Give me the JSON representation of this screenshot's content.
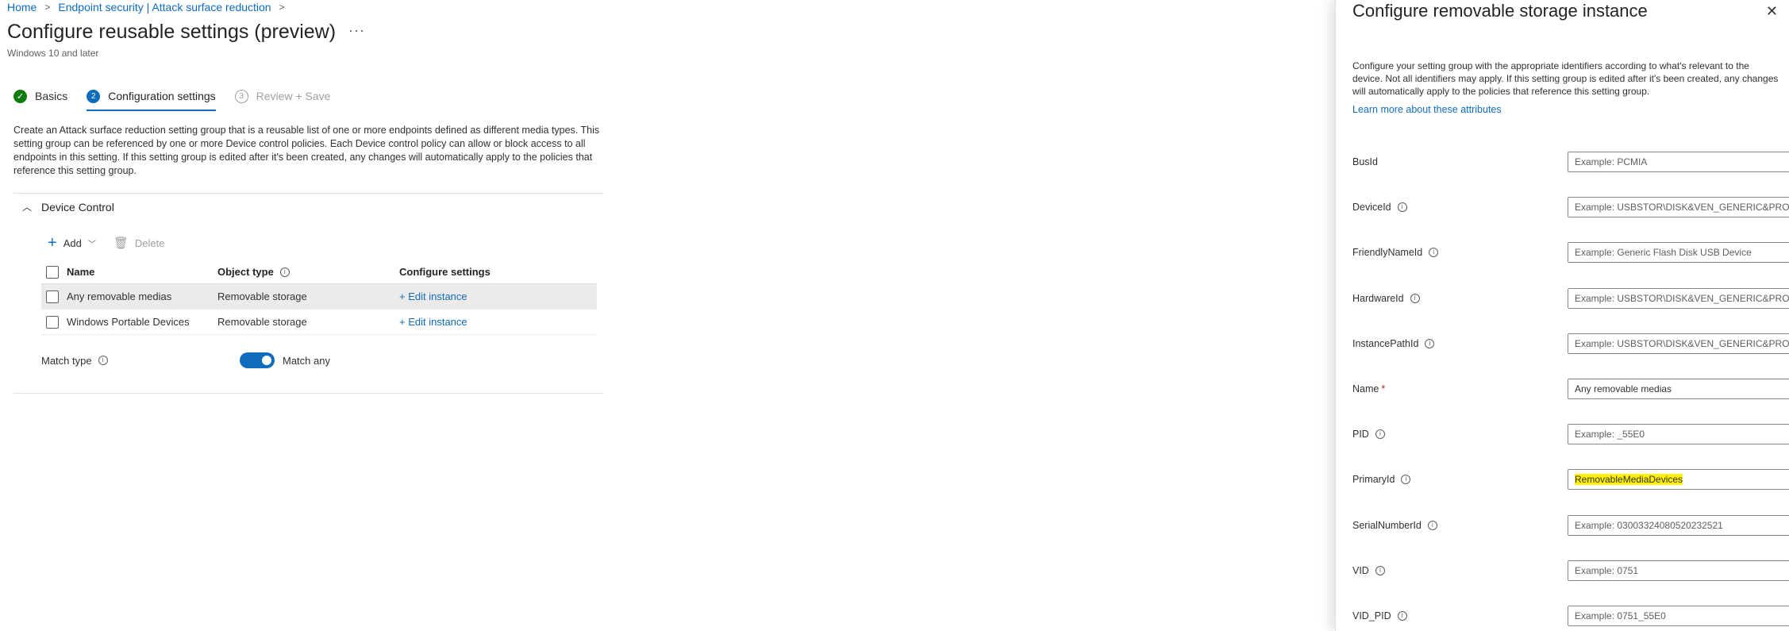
{
  "breadcrumb": [
    "Home",
    "Endpoint security | Attack surface reduction"
  ],
  "page": {
    "title": "Configure reusable settings (preview)",
    "more": "···",
    "subtitle": "Windows 10 and later"
  },
  "steps": [
    {
      "number": "✓",
      "label": "Basics",
      "state": "done"
    },
    {
      "number": "2",
      "label": "Configuration settings",
      "state": "active"
    },
    {
      "number": "3",
      "label": "Review + Save",
      "state": "future"
    }
  ],
  "description": "Create an Attack surface reduction setting group that is a reusable list of one or more endpoints defined as different media types. This setting group can be referenced by one or more Device control policies. Each Device control policy can allow or block access to all endpoints in this setting. If this setting group is edited after it's been created, any changes will automatically apply to the policies that reference this setting group.",
  "section": {
    "title": "Device Control"
  },
  "toolbar": {
    "add": "Add",
    "delete": "Delete"
  },
  "table": {
    "headers": {
      "name": "Name",
      "object_type": "Object type",
      "configure": "Configure settings"
    },
    "rows": [
      {
        "name": "Any removable medias",
        "type": "Removable storage",
        "action": "+ Edit instance"
      },
      {
        "name": "Windows Portable Devices",
        "type": "Removable storage",
        "action": "+ Edit instance"
      }
    ]
  },
  "match": {
    "label": "Match type",
    "value": "Match any",
    "toggle_on": true
  },
  "panel": {
    "title": "Configure removable storage instance",
    "close": "✕",
    "description": "Configure your setting group with the appropriate identifiers according to what's relevant to the device. Not all identifiers may apply. If this setting group is edited after it's been created, any changes will automatically apply to the policies that reference this setting group.",
    "learn_more": "Learn more about these attributes",
    "fields": [
      {
        "label": "BusId",
        "value": "Example: PCMIA",
        "info": false,
        "filled": false
      },
      {
        "label": "DeviceId",
        "value": "Example: USBSTOR\\DISK&VEN_GENERIC&PRO...",
        "info": true,
        "filled": false
      },
      {
        "label": "FriendlyNameId",
        "value": "Example: Generic Flash Disk USB Device",
        "info": true,
        "filled": false
      },
      {
        "label": "HardwareId",
        "value": "Example: USBSTOR\\DISK&VEN_GENERIC&PRO...",
        "info": true,
        "filled": false
      },
      {
        "label": "InstancePathId",
        "value": "Example: USBSTOR\\DISK&VEN_GENERIC&PRO...",
        "info": true,
        "filled": false
      },
      {
        "label": "Name",
        "value": "Any removable medias",
        "info": false,
        "filled": true,
        "required": "*"
      },
      {
        "label": "PID",
        "value": "Example: _55E0",
        "info": true,
        "filled": false
      },
      {
        "label": "PrimaryId",
        "value": "RemovableMediaDevices",
        "info": true,
        "filled": true,
        "highlight": true
      },
      {
        "label": "SerialNumberId",
        "value": "Example: 03003324080520232521",
        "info": true,
        "filled": false
      },
      {
        "label": "VID",
        "value": "Example: 0751",
        "info": true,
        "filled": false
      },
      {
        "label": "VID_PID",
        "value": "Example: 0751_55E0",
        "info": true,
        "filled": false
      }
    ]
  }
}
